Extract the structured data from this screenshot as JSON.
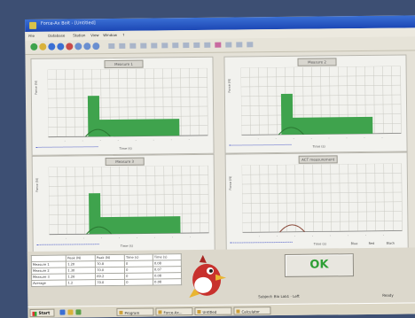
{
  "window": {
    "title": "Force-Ax Bolt - [Untitled]"
  },
  "menu": {
    "items": [
      "File",
      "Database",
      "Station",
      "View",
      "Window",
      "?"
    ]
  },
  "toolbar": {
    "colors": [
      "#3fa34d",
      "#d9b23a",
      "#3a6fd4",
      "#3a6fd4",
      "#c84a4a",
      "#6a8fd0",
      "#6a8fd0",
      "#6a8fd0"
    ]
  },
  "panels": [
    {
      "title": "Measure 1",
      "ylabel": "Force (N)",
      "xlabel": "Time (s)",
      "color": "#3fa34d"
    },
    {
      "title": "Measure 2",
      "ylabel": "Force (N)",
      "xlabel": "Time (s)",
      "color": "#3fa34d"
    },
    {
      "title": "Measure 3",
      "ylabel": "Force (N)",
      "xlabel": "Time (s)",
      "color": "#3fa34d"
    },
    {
      "title": "ACT measurement",
      "ylabel": "Force (N)",
      "xlabel": "Time (s)",
      "color": "#8a4a3a",
      "legend": [
        "Blue",
        "Red",
        "Black"
      ]
    }
  ],
  "results": {
    "headers": [
      "",
      "Peak (N)",
      "Peak (N)",
      "Time (s)",
      "Time (s)"
    ],
    "rows": [
      [
        "Measure 1",
        "1.20",
        "70.8",
        "0",
        "0.08"
      ],
      [
        "Measure 2",
        "1.30",
        "70.0",
        "0",
        "0.07"
      ],
      [
        "Measure 3",
        "1.26",
        "69.2",
        "0",
        "0.08"
      ],
      [
        "Average",
        "1.2",
        "70.0",
        "0",
        "0.08"
      ]
    ]
  },
  "ok_button": {
    "label": "OK"
  },
  "status": {
    "text": "Subject: Bio Lab1 - Left",
    "right": "Ready"
  },
  "taskbar": {
    "start": "Start",
    "tasks": [
      "Program",
      "Force-Ax...",
      "Untitled",
      "Calculator"
    ]
  }
}
